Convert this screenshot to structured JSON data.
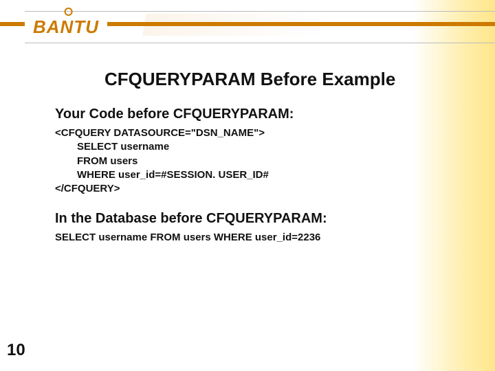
{
  "logo": {
    "text": "BANTU"
  },
  "slide": {
    "title": "CFQUERYPARAM Before Example",
    "section1_heading": "Your Code before CFQUERYPARAM:",
    "code_line1": "<CFQUERY DATASOURCE=\"DSN_NAME\">",
    "code_line2": "SELECT username",
    "code_line3": "FROM users",
    "code_line4": "WHERE user_id=#SESSION. USER_ID#",
    "code_line5": "</CFQUERY>",
    "section2_heading": "In the Database before CFQUERYPARAM:",
    "db_line": "SELECT username FROM users WHERE user_id=2236",
    "page_number": "10"
  }
}
